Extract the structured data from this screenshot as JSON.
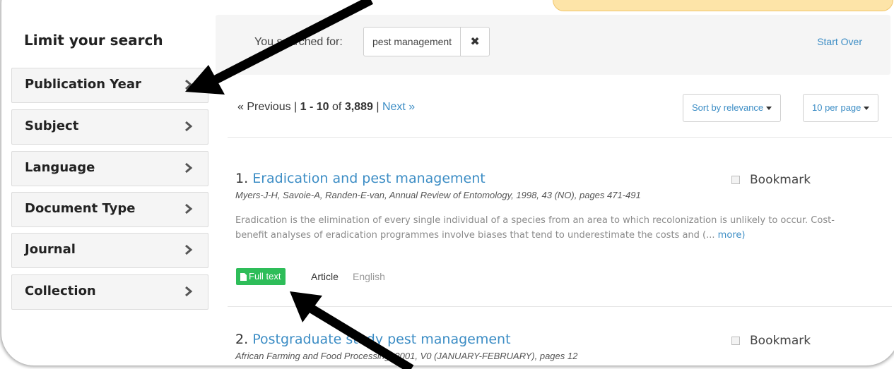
{
  "sidebar": {
    "title": "Limit your search",
    "facets": [
      {
        "label": "Publication Year"
      },
      {
        "label": "Subject"
      },
      {
        "label": "Language"
      },
      {
        "label": "Document Type"
      },
      {
        "label": "Journal"
      },
      {
        "label": "Collection"
      }
    ]
  },
  "search": {
    "label": "You searched for:",
    "query": "pest management",
    "remove": "✖",
    "start_over": "Start Over"
  },
  "paging": {
    "previous": "« Previous",
    "separator": "|",
    "range": "1 - 10",
    "of": "of",
    "total": "3,889",
    "next": "Next »"
  },
  "controls": {
    "sort_label": "Sort by relevance",
    "per_page_label": "10 per page"
  },
  "results": [
    {
      "number": "1.",
      "title": "Eradication and pest management",
      "meta": "Myers-J-H, Savoie-A, Randen-E-van, Annual Review of Entomology, 1998, 43 (NO), pages 471-491",
      "abstract": "Eradication is the elimination of every single individual of a species from an area to which recolonization is unlikely to occur. Cost-benefit analyses of eradication programmes involve biases that tend to underestimate the costs and (...",
      "more": "more)",
      "bookmark": "Bookmark",
      "badge": "Full text",
      "doc_type": "Article",
      "language": "English"
    },
    {
      "number": "2.",
      "title": "Postgraduate study pest management",
      "meta": "African Farming and Food Processing, 2001, V0 (JANUARY-FEBRUARY), pages 12",
      "bookmark": "Bookmark"
    }
  ],
  "colors": {
    "link": "#3c8dc5",
    "badge": "#2ebd59",
    "callout": "#fde4a8"
  }
}
